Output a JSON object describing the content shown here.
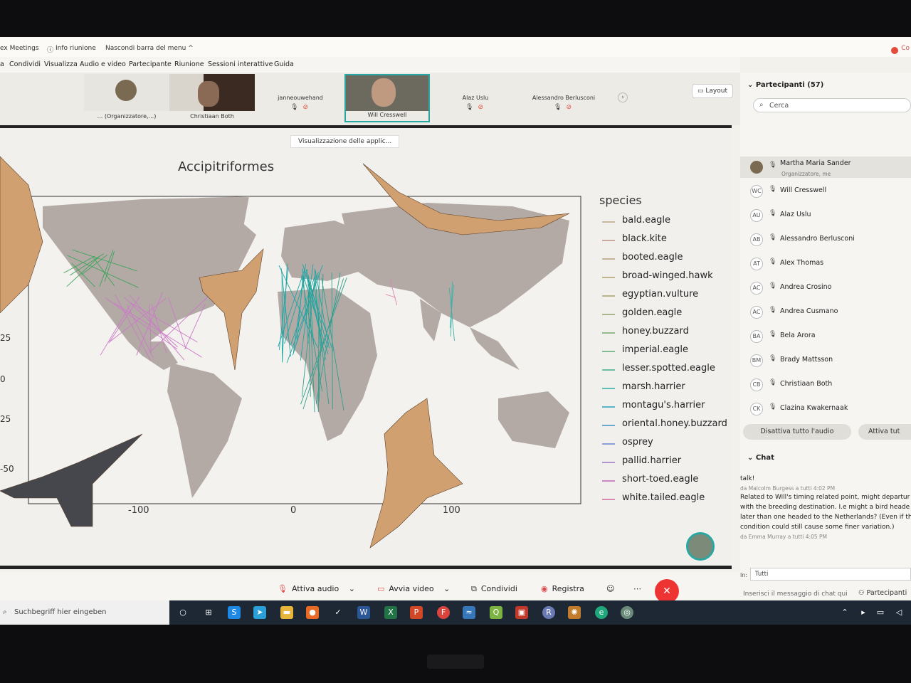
{
  "top_bar": {
    "app": "ex Meetings",
    "info": "Info riunione",
    "hide": "Nascondi barra del menu ^",
    "rec": "Co"
  },
  "menu": [
    "a",
    "Condividi",
    "Visualizza",
    "Audio e video",
    "Partecipante",
    "Riunione",
    "Sessioni interattive",
    "Guida"
  ],
  "filmstrip": {
    "tiles": [
      {
        "name": "... (Organizzatore,...)"
      },
      {
        "name": "Christiaan Both"
      },
      {
        "name": "janneouwehand"
      },
      {
        "name": "Will Cresswell"
      },
      {
        "name": "Alaz Uslu"
      },
      {
        "name": "Alessandro Berlusconi"
      }
    ],
    "layout_label": "Layout"
  },
  "share": {
    "label": "Visualizzazione delle applic...",
    "plot_title": "Accipitriformes",
    "legend_title": "species"
  },
  "chart_data": {
    "type": "line",
    "title": "Accipitriformes",
    "legend_title": "species",
    "x_ticks": [
      "-100",
      "0",
      "100"
    ],
    "y_ticks": [
      "25",
      "0",
      "25",
      "-50"
    ],
    "series": [
      {
        "name": "bald.eagle",
        "color": "#c8b8a0"
      },
      {
        "name": "black.kite",
        "color": "#c9a9a0"
      },
      {
        "name": "booted.eagle",
        "color": "#c6b49a"
      },
      {
        "name": "broad-winged.hawk",
        "color": "#bfb48e"
      },
      {
        "name": "egyptian.vulture",
        "color": "#b9b68a"
      },
      {
        "name": "golden.eagle",
        "color": "#a9b88c"
      },
      {
        "name": "honey.buzzard",
        "color": "#94bb8e"
      },
      {
        "name": "imperial.eagle",
        "color": "#7fbd96"
      },
      {
        "name": "lesser.spotted.eagle",
        "color": "#6cbfa4"
      },
      {
        "name": "marsh.harrier",
        "color": "#5cbdb4"
      },
      {
        "name": "montagu's.harrier",
        "color": "#58b6c6"
      },
      {
        "name": "oriental.honey.buzzard",
        "color": "#6aaad2"
      },
      {
        "name": "osprey",
        "color": "#8ca0d6"
      },
      {
        "name": "pallid.harrier",
        "color": "#b094d2"
      },
      {
        "name": "short-toed.eagle",
        "color": "#cc8ac4"
      },
      {
        "name": "white.tailed.eagle",
        "color": "#d88ab2"
      }
    ]
  },
  "participants": {
    "header": "Partecipanti (57)",
    "search_placeholder": "Cerca",
    "list": [
      {
        "initials": "",
        "name": "Martha Maria Sander",
        "sub": "Organizzatore, me"
      },
      {
        "initials": "WC",
        "name": "Will Cresswell"
      },
      {
        "initials": "AU",
        "name": "Alaz Uslu"
      },
      {
        "initials": "AB",
        "name": "Alessandro Berlusconi"
      },
      {
        "initials": "AT",
        "name": "Alex Thomas"
      },
      {
        "initials": "AC",
        "name": "Andrea Crosino"
      },
      {
        "initials": "AC",
        "name": "Andrea Cusmano"
      },
      {
        "initials": "BA",
        "name": "Bela Arora"
      },
      {
        "initials": "BM",
        "name": "Brady Mattsson"
      },
      {
        "initials": "CB",
        "name": "Christiaan Both"
      },
      {
        "initials": "CK",
        "name": "Clazina Kwakernaak"
      }
    ],
    "mute_all": "Disattiva tutto l'audio",
    "unmute_all": "Attiva tut"
  },
  "chat": {
    "header": "Chat",
    "line1": "talk!",
    "meta1": "da Malcolm Burgess a tutti   4:02 PM",
    "msg": [
      "Related to Will's timing related point, might departur",
      "with the breeding destination. I.e might a bird heade",
      "later than one headed to the Netherlands? (Even if th",
      "condition could still cause some finer variation.)"
    ],
    "meta2": "da Emma Murray a tutti   4:05 PM",
    "to_label": "In:",
    "to_value": "Tutti",
    "input_placeholder": "Inserisci il messaggio di chat qui"
  },
  "bottom": {
    "audio": "Attiva audio",
    "video": "Avvia video",
    "share": "Condividi",
    "record": "Registra",
    "participants": "Partecipanti"
  },
  "taskbar": {
    "search": "Suchbegriff hier eingeben"
  }
}
